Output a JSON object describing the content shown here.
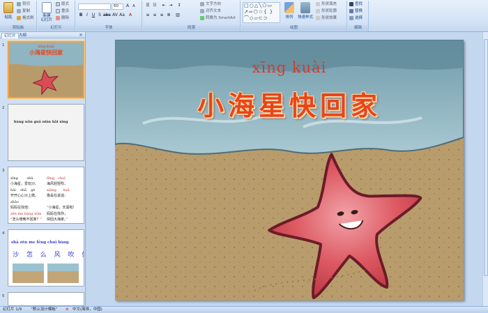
{
  "ribbon": {
    "groups": {
      "clipboard": "剪贴板",
      "slides": "幻灯片",
      "font": "字体",
      "paragraph": "段落",
      "drawing": "绘图",
      "editing": "编辑"
    },
    "clipboard": {
      "paste": "粘贴",
      "cut": "剪切",
      "copy": "复制",
      "format_painter": "格式刷"
    },
    "slides": {
      "new_slide": "新建\n幻灯片",
      "layout": "版式",
      "reset": "重设",
      "delete": "删除"
    },
    "font": {
      "font_size": "60"
    },
    "paragraph": {
      "text_direction": "文字方向",
      "align_text": "对齐文本",
      "smartart": "转换为 SmartArt"
    },
    "drawing": {
      "arrange": "排列",
      "quick_styles": "快速样式",
      "shape_fill": "形状填充",
      "shape_outline": "形状轮廓",
      "shape_effects": "形状效果"
    },
    "editing": {
      "find": "查找",
      "replace": "替换",
      "select": "选择"
    }
  },
  "panel": {
    "tab_slides": "幻灯片",
    "tab_outline": "大纲",
    "close": "×",
    "numbers": [
      "1",
      "2",
      "3",
      "4",
      "5"
    ]
  },
  "thumb1": {
    "pinyin": "xīng kuài",
    "title": "小海星快回家"
  },
  "thumb2": {
    "pinyin": "bàng wǎn    guā niān    hǎi xīng"
  },
  "thumb3": {
    "lines": [
      "xīng        shā",
      "小海星，爱玩沙。",
      "hǎi    shā    gè",
      "开开心心沙上爬。",
      "zhǎo",
      "妈妈在找他：",
      "zěn me bàng wǎn",
      "“怎么傍晚不回家？”"
    ],
    "right_lines": [
      "fēng   chuī",
      "海风轻轻吹，",
      "xiāng      huā",
      "像是在说话：",
      "",
      "“小海星，天黑啦！",
      "妈妈在找你，",
      "快回大海家。”"
    ]
  },
  "thumb4": {
    "pinyin": "shā zěn me  fēng chuī bàng",
    "chars": "沙 怎 么 风 吹 傍"
  },
  "slide": {
    "pinyin": "xīng  kuài",
    "title": "小海星快回家"
  },
  "status": {
    "slide_info": "幻灯片 1/9",
    "theme": "“默认设计模板”",
    "language": "中文(简体，中国)"
  },
  "colors": {
    "ribbon_bg": "#d3e3f6",
    "title_red": "#e8451a",
    "pinyin_red": "#d63a2a",
    "starfish": "#d94c55",
    "sand": "#b79a6a",
    "sea": "#8fb4c2"
  }
}
